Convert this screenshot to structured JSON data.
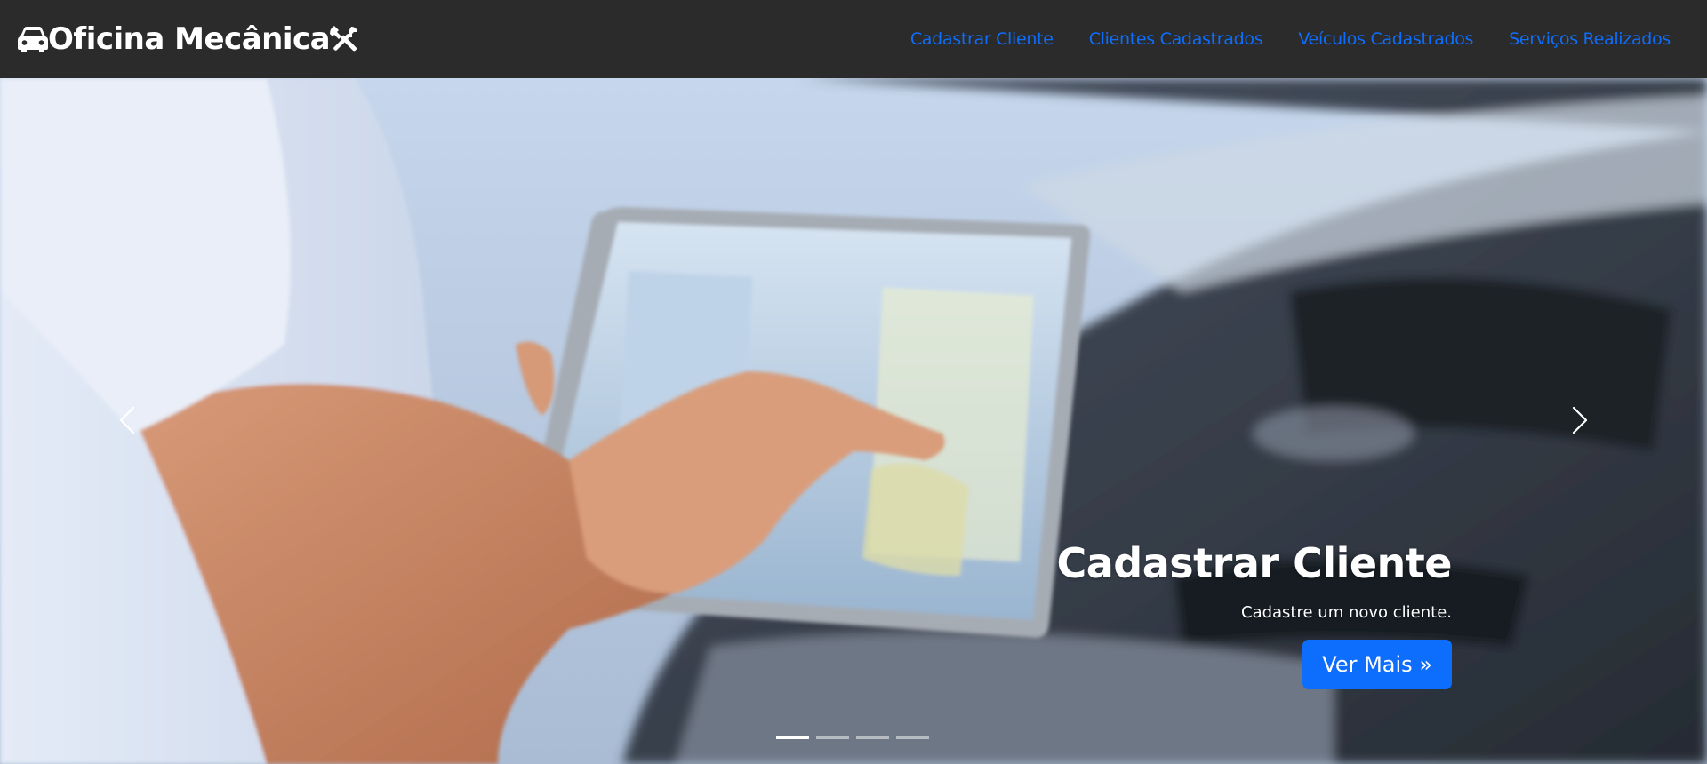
{
  "brand": {
    "name": "Oficina Mecânica",
    "left_icon": "car-icon",
    "right_icon": "tools-icon"
  },
  "nav": {
    "items": [
      {
        "label": "Cadastrar Cliente"
      },
      {
        "label": "Clientes Cadastrados"
      },
      {
        "label": "Veículos Cadastrados"
      },
      {
        "label": "Serviços Realizados"
      }
    ]
  },
  "carousel": {
    "slide": {
      "title": "Cadastrar Cliente",
      "text": "Cadastre um novo cliente.",
      "button_label": "Ver Mais »"
    },
    "prev_icon": "chevron-left-icon",
    "next_icon": "chevron-right-icon",
    "indicator_count": 4,
    "active_index": 0
  },
  "colors": {
    "navbar_bg": "#2b2b2b",
    "link": "#0d6efd",
    "button_bg": "#0d6efd"
  }
}
